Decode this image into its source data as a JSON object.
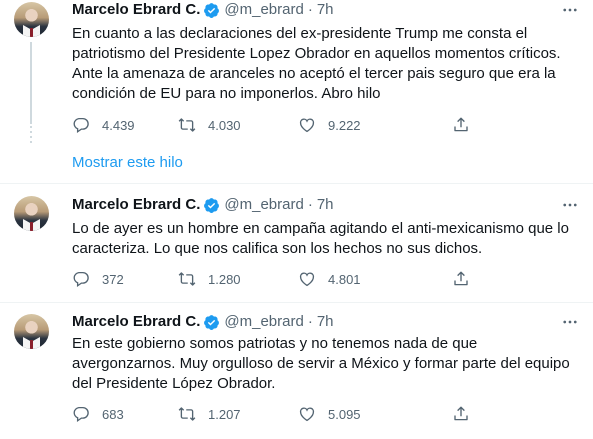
{
  "colors": {
    "accent": "#1d9bf0",
    "text": "#0f1419",
    "muted": "#536471",
    "border": "#eff3f4"
  },
  "icons": {
    "reply": "reply-icon",
    "retweet": "retweet-icon",
    "like": "like-icon",
    "share": "share-icon",
    "verified": "verified-badge-icon",
    "more": "more-icon"
  },
  "show_thread": "Mostrar este hilo",
  "tweets": [
    {
      "name": "Marcelo Ebrard C.",
      "handle": "@m_ebrard",
      "dot": "·",
      "time": "7h",
      "text": "En cuanto a las declaraciones del ex-presidente Trump me consta el patriotismo del Presidente Lopez Obrador en aquellos momentos críticos. Ante la amenaza de aranceles no aceptó el tercer pais seguro que era la condición de EU para no imponerlos. Abro hilo",
      "replies": "4.439",
      "retweets": "4.030",
      "likes": "9.222"
    },
    {
      "name": "Marcelo Ebrard C.",
      "handle": "@m_ebrard",
      "dot": "·",
      "time": "7h",
      "text": "Lo de ayer es un hombre en campaña agitando el anti-mexicanismo que lo caracteriza. Lo que nos califica son los hechos no sus dichos.",
      "replies": "372",
      "retweets": "1.280",
      "likes": "4.801"
    },
    {
      "name": "Marcelo Ebrard C.",
      "handle": "@m_ebrard",
      "dot": "·",
      "time": "7h",
      "text": "En este gobierno somos patriotas y no tenemos nada de que avergonzarnos. Muy orgulloso de servir a México y formar parte del equipo del Presidente López Obrador.",
      "replies": "683",
      "retweets": "1.207",
      "likes": "5.095"
    }
  ]
}
